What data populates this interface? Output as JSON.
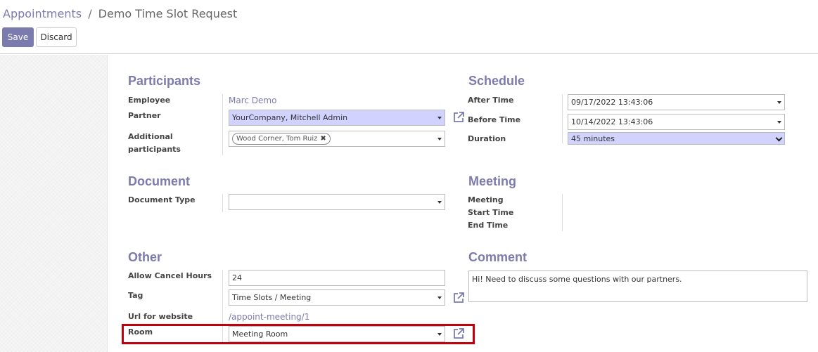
{
  "breadcrumb": {
    "parent": "Appointments",
    "separator": "/",
    "current": "Demo Time Slot Request"
  },
  "toolbar": {
    "save_label": "Save",
    "discard_label": "Discard"
  },
  "participants": {
    "title": "Participants",
    "employee_label": "Employee",
    "employee_value": "Marc Demo",
    "partner_label": "Partner",
    "partner_value": "YourCompany, Mitchell Admin",
    "additional_label_1": "Additional",
    "additional_label_2": "participants",
    "additional_tags": [
      "Wood Corner, Tom Ruiz"
    ],
    "tag_remove_glyph": "✖"
  },
  "schedule": {
    "title": "Schedule",
    "after_label": "After Time",
    "after_value": "09/17/2022 13:43:06",
    "before_label": "Before Time",
    "before_value": "10/14/2022 13:43:06",
    "duration_label": "Duration",
    "duration_value": "45 minutes"
  },
  "document": {
    "title": "Document",
    "type_label": "Document Type",
    "type_value": ""
  },
  "meeting": {
    "title": "Meeting",
    "meeting_label": "Meeting",
    "start_label": "Start Time",
    "end_label": "End Time"
  },
  "other": {
    "title": "Other",
    "cancel_label": "Allow Cancel Hours",
    "cancel_value": "24",
    "tag_label": "Tag",
    "tag_value": "Time Slots / Meeting",
    "url_label": "Url for website",
    "url_value": "/appoint-meeting/1",
    "room_label": "Room",
    "room_value": "Meeting Room"
  },
  "comment": {
    "title": "Comment",
    "text": "Hi! Need to discuss some questions with our partners."
  },
  "colors": {
    "accent": "#7c7bad",
    "highlight_field": "#d2d2ff",
    "annotation_box": "#c0000c"
  },
  "icons": {
    "external_link": "external-link-icon",
    "dropdown": "caret-down-icon"
  }
}
